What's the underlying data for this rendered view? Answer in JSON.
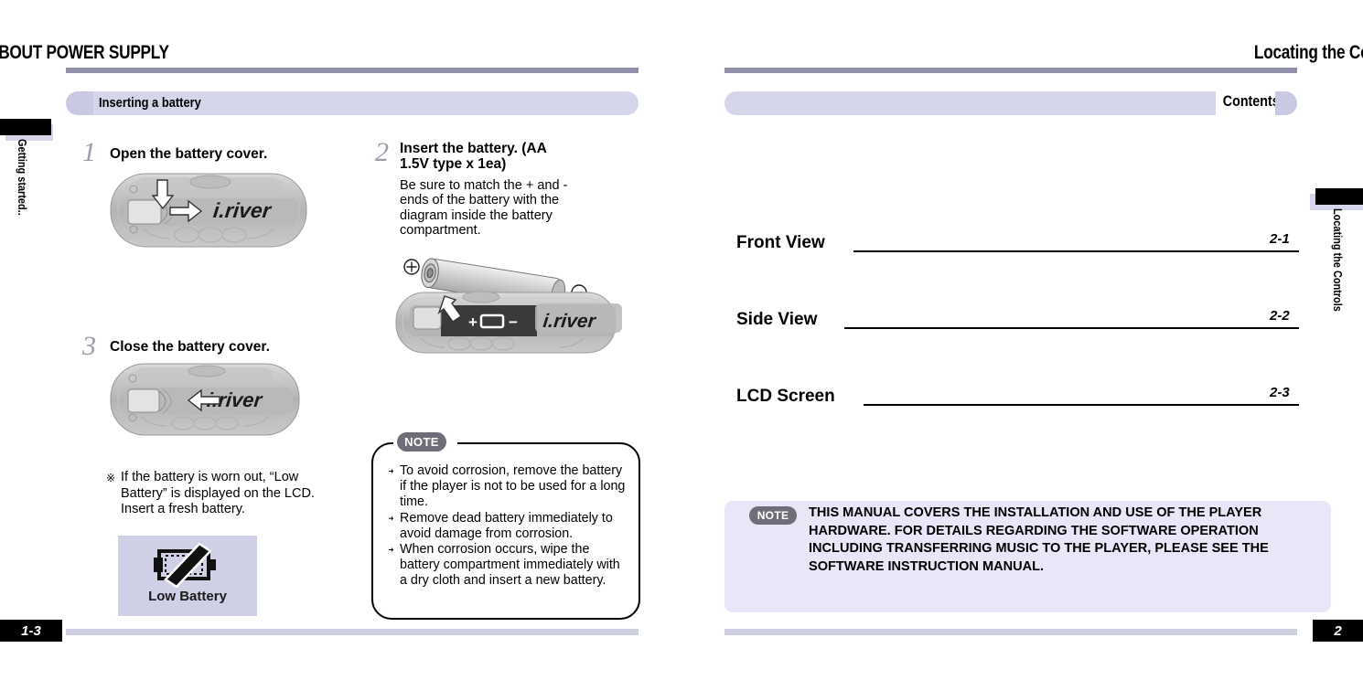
{
  "left_page": {
    "header_title": "ABOUT POWER SUPPLY",
    "section_label": "Inserting a battery",
    "side_tab": "Getting started..",
    "steps": [
      {
        "num": "1",
        "heading": "Open the battery cover.",
        "body": ""
      },
      {
        "num": "2",
        "heading": "Insert the battery. (AA 1.5V type x 1ea)",
        "body": "Be sure to match the + and - ends of the battery with the diagram inside the battery compartment."
      },
      {
        "num": "3",
        "heading": "Close the battery cover.",
        "body": ""
      }
    ],
    "asterisk_note": {
      "mark": "※",
      "text": "If the battery is worn out, “Low Battery” is displayed on the LCD. Insert a fresh battery."
    },
    "low_battery": {
      "label": "Low Battery"
    },
    "note_box": {
      "badge": "NOTE",
      "items": [
        "To avoid corrosion, remove the battery if the player is not to be used for a long time.",
        "Remove dead battery immediately to avoid damage from corrosion.",
        "When corrosion occurs, wipe the battery compartment immediately with a dry cloth and insert a new battery."
      ]
    },
    "device_brand": "iriver",
    "battery_polarity": {
      "plus": "+",
      "minus": "−"
    },
    "footer_page": "1-3"
  },
  "right_page": {
    "header_title": "Locating the Controls",
    "contents_label": "Contents",
    "side_tab": "Locating the Controls",
    "toc": [
      {
        "label": "Front View",
        "page": "2-1"
      },
      {
        "label": "Side View",
        "page": "2-2"
      },
      {
        "label": "LCD Screen",
        "page": "2-3"
      }
    ],
    "note_box": {
      "badge": "NOTE",
      "text": "THIS MANUAL COVERS THE INSTALLATION AND USE OF THE PLAYER HARDWARE. FOR DETAILS REGARDING THE SOFTWARE OPERATION INCLUDING TRANSFERRING MUSIC TO THE PLAYER, PLEASE SEE THE SOFTWARE INSTRUCTION MANUAL."
    },
    "footer_page": "2"
  },
  "colors": {
    "rule": "#8f8fa8",
    "lavender_bar": "#d6d6ea",
    "lavender_cap": "#c9c9e3",
    "note_badge": "#6e6e78",
    "note_panel": "#e7e7f7",
    "low_battery_bg": "#cfcfe6",
    "footer_rule": "#cfcfe2"
  }
}
